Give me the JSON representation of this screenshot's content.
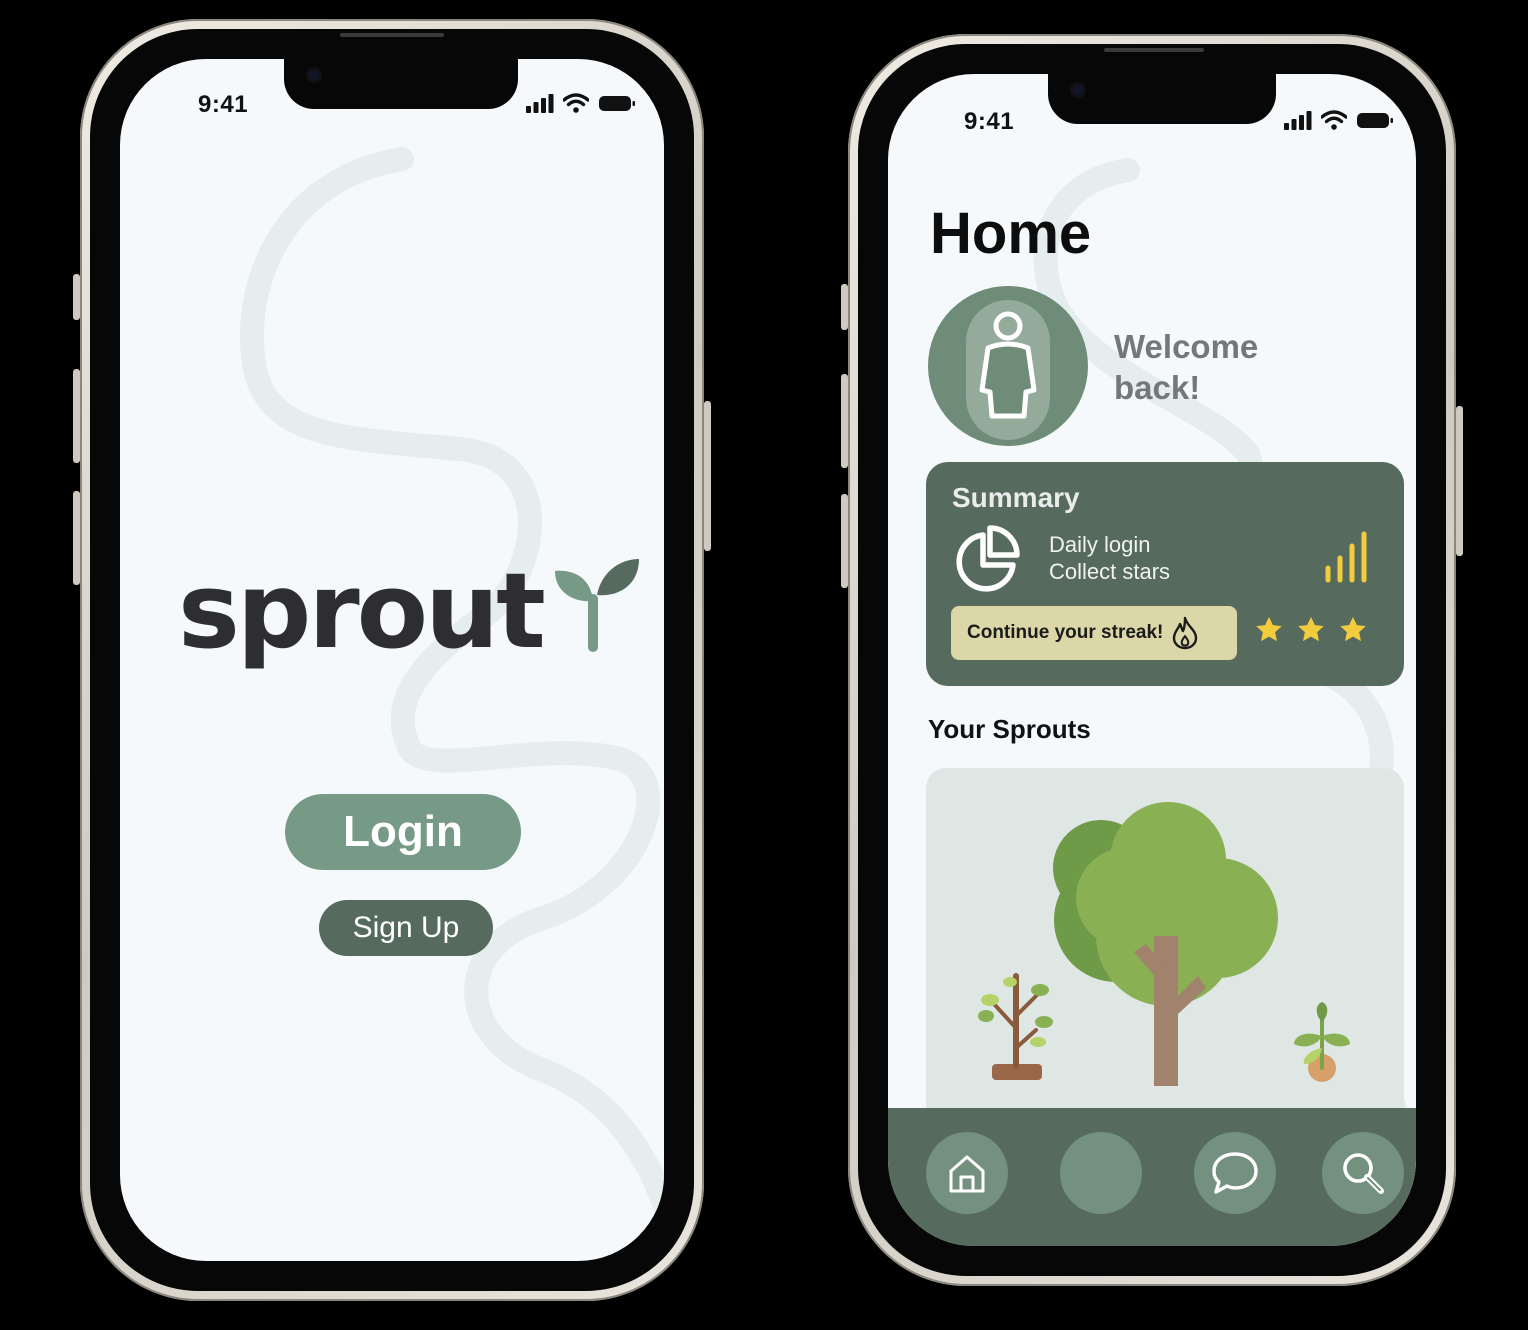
{
  "screens": {
    "login": {
      "status_time": "9:41",
      "logo_text": "sprout",
      "login_label": "Login",
      "signup_label": "Sign Up"
    },
    "home": {
      "status_time": "9:41",
      "title": "Home",
      "welcome_line1": "Welcome",
      "welcome_line2": "back!",
      "summary": {
        "title": "Summary",
        "line1": "Daily login",
        "line2": "Collect stars",
        "streak_label": "Continue your streak!",
        "stars_count": 3
      },
      "sprouts_title": "Your Sprouts",
      "tabs": [
        "home-icon",
        "profile-tab",
        "chat-icon",
        "search-icon"
      ]
    }
  },
  "colors": {
    "primary_green": "#779a87",
    "dark_green": "#566a5e",
    "streak_bg": "#dcd7a9",
    "star": "#f2cc3c",
    "background": "#f6f9fb"
  }
}
